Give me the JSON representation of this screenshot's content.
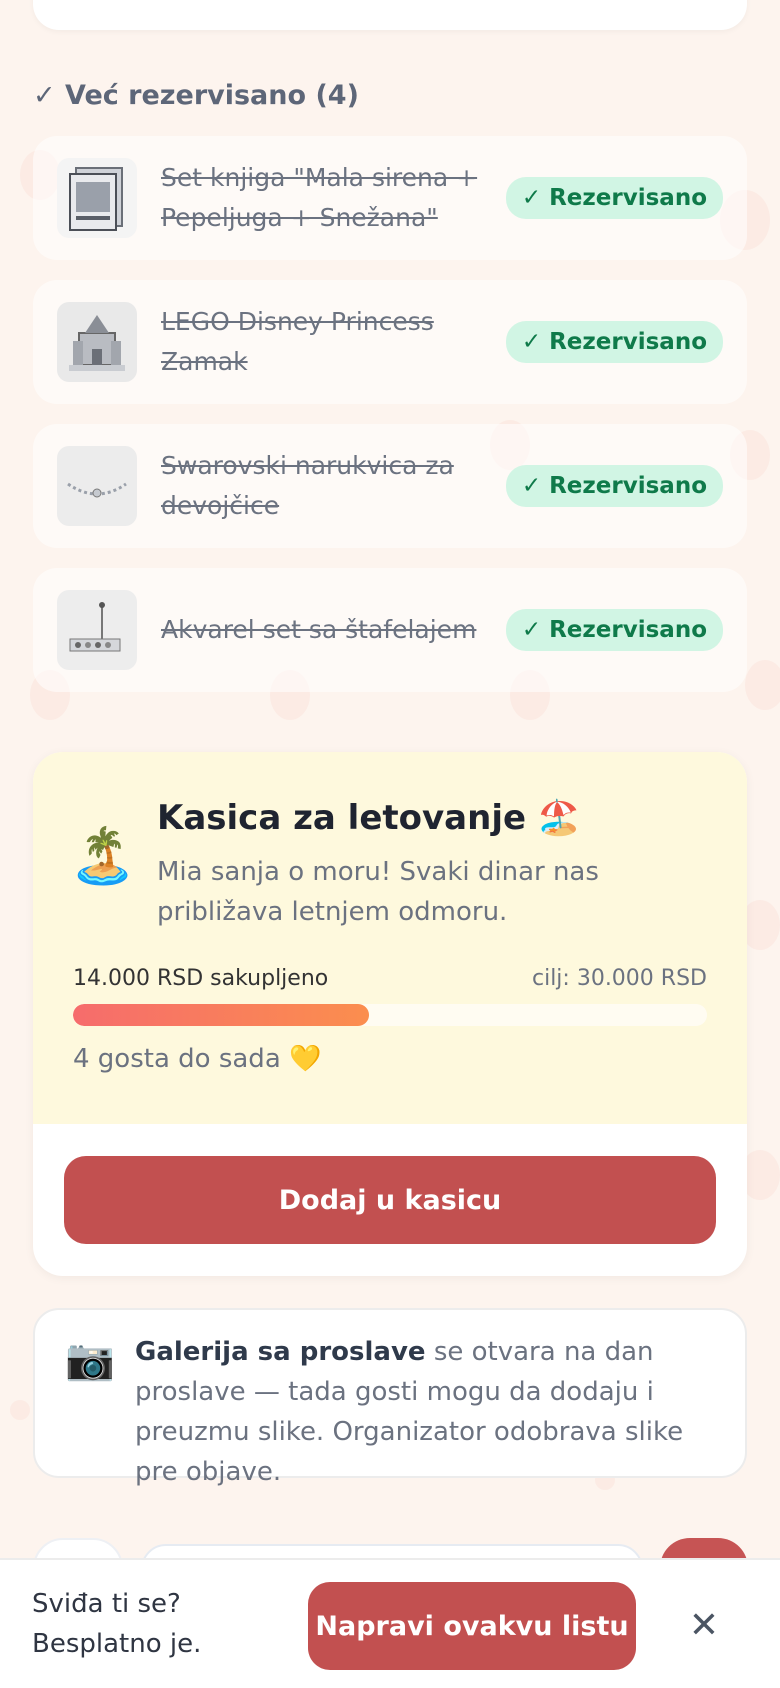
{
  "reserved": {
    "title": "✓ Već rezervisano (4)",
    "items": [
      {
        "name": "Set knjiga \"Mala sirena + Pepeljuga + Snežana\"",
        "badge": "✓ Rezervisano",
        "icon": "book-set-icon"
      },
      {
        "name": "LEGO Disney Princess Zamak",
        "badge": "✓ Rezervisano",
        "icon": "castle-icon"
      },
      {
        "name": "Swarovski narukvica za devojčice",
        "badge": "✓ Rezervisano",
        "icon": "bracelet-icon"
      },
      {
        "name": "Akvarel set sa štafelajem",
        "badge": "✓ Rezervisano",
        "icon": "paint-set-icon"
      }
    ]
  },
  "fund": {
    "emoji": "🏝️",
    "title": "Kasica za letovanje 🏖️",
    "description": "Mia sanja o moru! Svaki dinar nas približava letnjem odmoru.",
    "collected": "14.000 RSD sakupljeno",
    "goal": "cilj: 30.000 RSD",
    "progress_fraction": 0.4667,
    "guests": "4 gosta do sada 💛",
    "button": "Dodaj u kasicu"
  },
  "gallery": {
    "icon": "📷",
    "bold": "Galerija sa proslave",
    "text": " se otvara na dan proslave — tada gosti mogu da dodaju i preuzmu slike. Organizator odobrava slike pre objave."
  },
  "promo": {
    "line1": "Sviđa ti se?",
    "line2": "Besplatno je.",
    "button": "Napravi ovakvu listu",
    "close": "✕"
  },
  "colors": {
    "accent": "#c25050",
    "badge_bg": "#d1f5e4",
    "badge_text": "#0f7a4a",
    "fund_bg": "#fef9dd"
  }
}
